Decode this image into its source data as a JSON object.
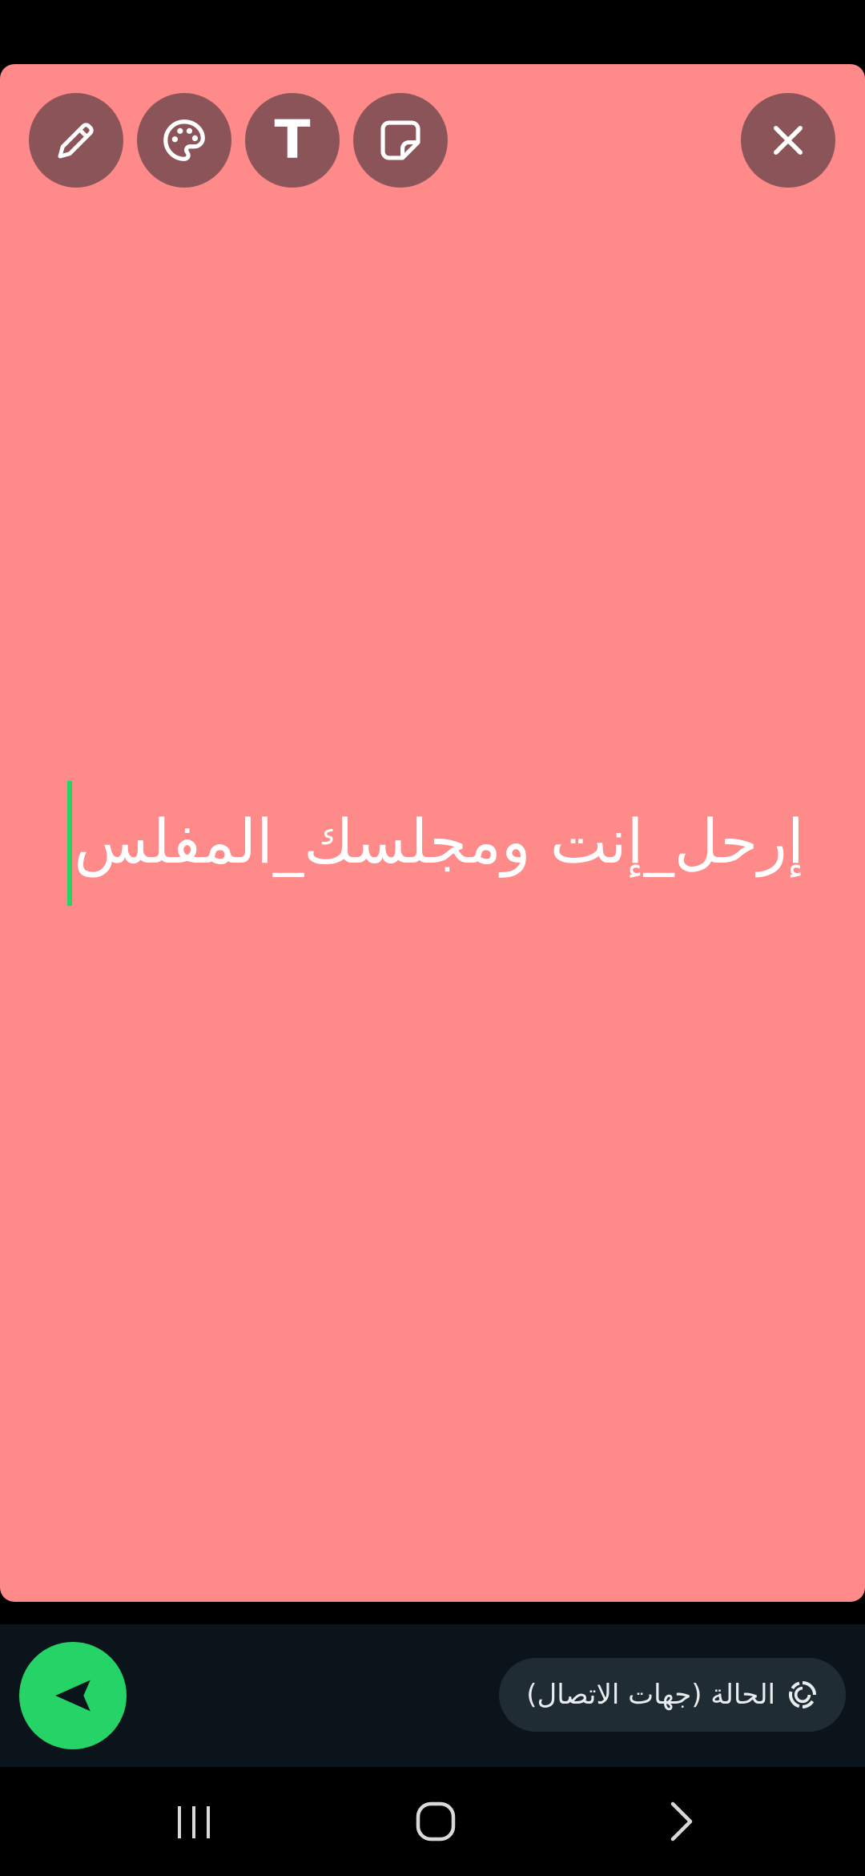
{
  "editor": {
    "status_text": "إرحل_إنت ومجلسك_المفلس",
    "background_color": "#ff8a8a"
  },
  "toolbar": {
    "tools": [
      {
        "icon": "pencil-icon"
      },
      {
        "icon": "palette-icon"
      },
      {
        "icon": "text-icon",
        "glyph": "T"
      },
      {
        "icon": "sticker-icon"
      }
    ],
    "close_icon": "close-icon"
  },
  "footer": {
    "privacy_label": "الحالة (جهات الاتصال)",
    "privacy_icon": "status-ring-icon",
    "send_icon": "send-icon",
    "accent_color": "#25d366"
  },
  "navigation": {
    "items": [
      "recent-apps-icon",
      "home-icon",
      "back-icon"
    ]
  }
}
